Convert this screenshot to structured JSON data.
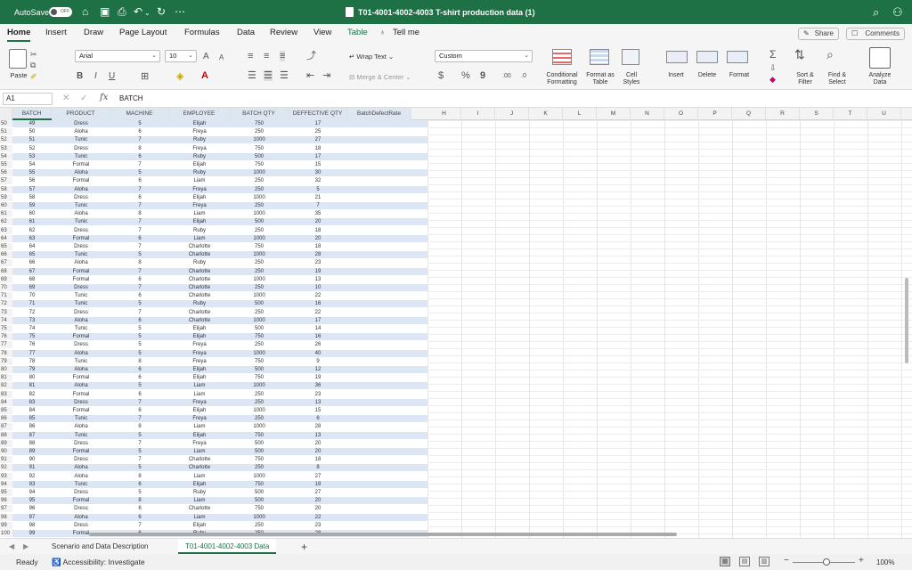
{
  "titlebar": {
    "autosave_label": "AutoSave",
    "autosave_state": "OFF",
    "title": "T01-4001-4002-4003 T-shirt production data (1)",
    "title_icon": "excel-doc-icon"
  },
  "menu": {
    "tabs": [
      "Home",
      "Insert",
      "Draw",
      "Page Layout",
      "Formulas",
      "Data",
      "Review",
      "View",
      "Table",
      "Tell me"
    ],
    "active": "Home",
    "share_label": "Share",
    "comments_label": "Comments"
  },
  "ribbon": {
    "paste_label": "Paste",
    "font_name": "Arial",
    "font_size": "10",
    "font_grow": "A",
    "font_shrink": "A",
    "bold": "B",
    "italic": "I",
    "underline": "U",
    "wrap_text": "Wrap Text",
    "merge_center": "Merge & Center",
    "number_format": "Custom",
    "currency": "$",
    "percent": "%",
    "comma": "9",
    "inc_decimal": ".00",
    "dec_decimal": ".0",
    "conditional_formatting": "Conditional Formatting",
    "format_as_table": "Format as Table",
    "cell_styles": "Cell Styles",
    "insert": "Insert",
    "delete": "Delete",
    "format": "Format",
    "sort_filter": "Sort & Filter",
    "find_select": "Find & Select",
    "analyze_data": "Analyze Data"
  },
  "formula_bar": {
    "name_box": "A1",
    "content": "BATCH"
  },
  "columns": [
    "BATCH",
    "PRODUCT",
    "MACHINE",
    "EMPLOYEE",
    "BATCH QTY",
    "DEFFECTIVE QTY",
    "BatchDefectRate",
    "H",
    "I",
    "J",
    "K",
    "L",
    "M",
    "N",
    "O",
    "P",
    "Q",
    "R",
    "S",
    "T",
    "U"
  ],
  "row_numbers": [
    50,
    51,
    52,
    53,
    54,
    55,
    56,
    57,
    58,
    59,
    60,
    61,
    62,
    63,
    64,
    65,
    66,
    67,
    68,
    69,
    70,
    71,
    72,
    73,
    74,
    75,
    76,
    77,
    78,
    79,
    80,
    81,
    82,
    83,
    84,
    85,
    86,
    87,
    88,
    89,
    90,
    91,
    92,
    93,
    94,
    95,
    96,
    97,
    98,
    99,
    100
  ],
  "rows": [
    [
      "49",
      "Dress",
      "5",
      "Elijah",
      "750",
      "17"
    ],
    [
      "50",
      "Aloha",
      "6",
      "Freya",
      "250",
      "25"
    ],
    [
      "51",
      "Tunic",
      "7",
      "Ruby",
      "1000",
      "27"
    ],
    [
      "52",
      "Dress",
      "8",
      "Freya",
      "750",
      "18"
    ],
    [
      "53",
      "Tunic",
      "6",
      "Ruby",
      "500",
      "17"
    ],
    [
      "54",
      "Formal",
      "7",
      "Elijah",
      "750",
      "15"
    ],
    [
      "55",
      "Aloha",
      "5",
      "Ruby",
      "1000",
      "30"
    ],
    [
      "56",
      "Formal",
      "6",
      "Liam",
      "250",
      "32"
    ],
    [
      "57",
      "Aloha",
      "7",
      "Freya",
      "250",
      "5"
    ],
    [
      "58",
      "Dress",
      "6",
      "Elijah",
      "1000",
      "21"
    ],
    [
      "59",
      "Tunic",
      "7",
      "Freya",
      "250",
      "7"
    ],
    [
      "60",
      "Aloha",
      "8",
      "Liam",
      "1000",
      "35"
    ],
    [
      "61",
      "Tunic",
      "7",
      "Elijah",
      "500",
      "20"
    ],
    [
      "62",
      "Dress",
      "7",
      "Ruby",
      "250",
      "18"
    ],
    [
      "63",
      "Formal",
      "6",
      "Liam",
      "1000",
      "20"
    ],
    [
      "64",
      "Dress",
      "7",
      "Charlotte",
      "750",
      "18"
    ],
    [
      "65",
      "Tunic",
      "5",
      "Charlotte",
      "1000",
      "28"
    ],
    [
      "66",
      "Aloha",
      "8",
      "Ruby",
      "250",
      "23"
    ],
    [
      "67",
      "Formal",
      "7",
      "Charlotte",
      "250",
      "19"
    ],
    [
      "68",
      "Formal",
      "6",
      "Charlotte",
      "1000",
      "13"
    ],
    [
      "69",
      "Dress",
      "7",
      "Charlotte",
      "250",
      "10"
    ],
    [
      "70",
      "Tunic",
      "6",
      "Charlotte",
      "1000",
      "22"
    ],
    [
      "71",
      "Tunic",
      "5",
      "Ruby",
      "500",
      "16"
    ],
    [
      "72",
      "Dress",
      "7",
      "Charlotte",
      "250",
      "22"
    ],
    [
      "73",
      "Aloha",
      "6",
      "Charlotte",
      "1000",
      "17"
    ],
    [
      "74",
      "Tunic",
      "5",
      "Elijah",
      "500",
      "14"
    ],
    [
      "75",
      "Formal",
      "5",
      "Elijah",
      "750",
      "16"
    ],
    [
      "76",
      "Dress",
      "5",
      "Freya",
      "250",
      "26"
    ],
    [
      "77",
      "Aloha",
      "5",
      "Freya",
      "1000",
      "40"
    ],
    [
      "78",
      "Tunic",
      "8",
      "Freya",
      "750",
      "9"
    ],
    [
      "79",
      "Aloha",
      "6",
      "Elijah",
      "500",
      "12"
    ],
    [
      "80",
      "Formal",
      "6",
      "Elijah",
      "750",
      "19"
    ],
    [
      "81",
      "Aloha",
      "5",
      "Liam",
      "1000",
      "36"
    ],
    [
      "82",
      "Formal",
      "6",
      "Liam",
      "250",
      "23"
    ],
    [
      "83",
      "Dress",
      "7",
      "Freya",
      "250",
      "13"
    ],
    [
      "84",
      "Formal",
      "6",
      "Elijah",
      "1000",
      "15"
    ],
    [
      "85",
      "Tunic",
      "7",
      "Freya",
      "250",
      "6"
    ],
    [
      "86",
      "Aloha",
      "8",
      "Liam",
      "1000",
      "28"
    ],
    [
      "87",
      "Tunic",
      "5",
      "Elijah",
      "750",
      "13"
    ],
    [
      "88",
      "Dress",
      "7",
      "Freya",
      "500",
      "20"
    ],
    [
      "89",
      "Formal",
      "5",
      "Liam",
      "500",
      "20"
    ],
    [
      "90",
      "Dress",
      "7",
      "Charlotte",
      "750",
      "18"
    ],
    [
      "91",
      "Aloha",
      "5",
      "Charlotte",
      "250",
      "8"
    ],
    [
      "92",
      "Aloha",
      "8",
      "Liam",
      "1000",
      "27"
    ],
    [
      "93",
      "Tunic",
      "6",
      "Elijah",
      "750",
      "18"
    ],
    [
      "94",
      "Dress",
      "5",
      "Ruby",
      "500",
      "27"
    ],
    [
      "95",
      "Formal",
      "8",
      "Liam",
      "500",
      "20"
    ],
    [
      "96",
      "Dress",
      "6",
      "Charlotte",
      "750",
      "20"
    ],
    [
      "97",
      "Aloha",
      "6",
      "Liam",
      "1000",
      "22"
    ],
    [
      "98",
      "Dress",
      "7",
      "Elijah",
      "250",
      "23"
    ],
    [
      "99",
      "Formal",
      "6",
      "Ruby",
      "250",
      "28"
    ]
  ],
  "sheet_tabs": [
    "Scenario and Data Description",
    "T01-4001-4002-4003 Data"
  ],
  "active_sheet": "T01-4001-4002-4003 Data",
  "status": {
    "ready": "Ready",
    "accessibility": "Accessibility: Investigate",
    "zoom": "100%"
  },
  "colors": {
    "brand": "#1e7145",
    "band": "#dce6f5",
    "header": "#dde6f1"
  }
}
